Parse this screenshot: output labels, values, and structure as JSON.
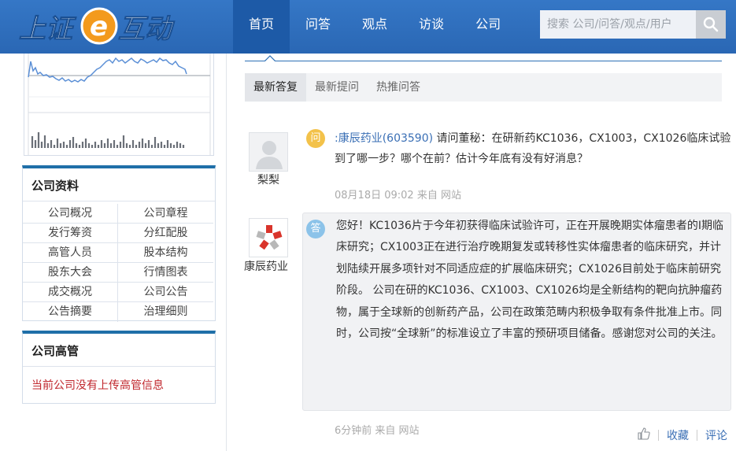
{
  "header": {
    "logo_text": "上证e互动",
    "nav": [
      {
        "label": "首页"
      },
      {
        "label": "问答"
      },
      {
        "label": "观点"
      },
      {
        "label": "访谈"
      },
      {
        "label": "公司"
      }
    ],
    "search_placeholder": "搜索 公司/问答/观点/用户"
  },
  "sidebar": {
    "company_info": {
      "title": "公司资料",
      "links": [
        "公司概况",
        "公司章程",
        "发行筹资",
        "分红配股",
        "高管人员",
        "股本结构",
        "股东大会",
        "行情图表",
        "成交概况",
        "公司公告",
        "公告摘要",
        "治理细则"
      ]
    },
    "management": {
      "title": "公司高管",
      "empty_text": "当前公司没有上传高管信息"
    }
  },
  "tabs": [
    {
      "label": "最新答复"
    },
    {
      "label": "最新提问"
    },
    {
      "label": "热推问答"
    }
  ],
  "question": {
    "asker_name": "梨梨",
    "badge": "问",
    "company_tag": ":康辰药业(603590)",
    "text": "请问董秘：在研新药KC1036，CX1003，CX1026临床试验到了哪一步？哪个在前？估计今年底有没有好消息？",
    "meta": "08月18日 09:02 来自 网站"
  },
  "answer": {
    "responder_name": "康辰药业",
    "badge": "答",
    "text": "您好！KC1036片于今年初获得临床试验许可，正在开展晚期实体瘤患者的I期临床研究；CX1003正在进行治疗晚期复发或转移性实体瘤患者的临床研究，并计划陆续开展多项针对不同适应症的扩展临床研究；CX1026目前处于临床前研究阶段。 公司在研的KC1036、CX1003、CX1026均是全新结构的靶向抗肿瘤药物，属于全球新的创新药产品，公司在政策范畴内积极争取有条件批准上市。同时，公司按“全球新”的标准设立了丰富的预研项目储备。感谢您对公司的关注。",
    "meta": "6分钟前 来自 网站"
  },
  "actions": {
    "like_icon": "thumbs-up-icon",
    "favorite": "收藏",
    "comment": "评论"
  }
}
